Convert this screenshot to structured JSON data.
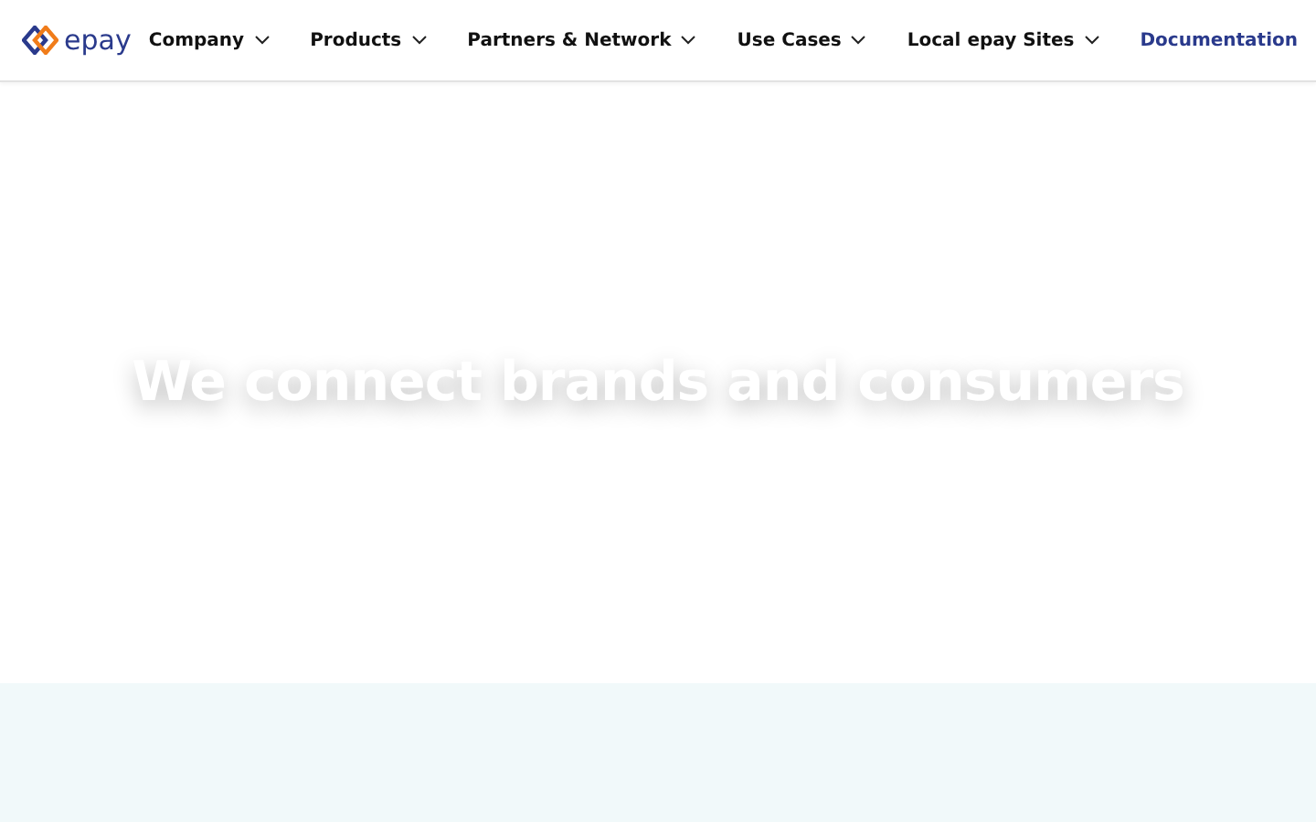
{
  "header": {
    "logo": "epay",
    "nav": [
      {
        "label": "Company",
        "kind": "dropdown"
      },
      {
        "label": "Products",
        "kind": "dropdown"
      },
      {
        "label": "Partners & Network",
        "kind": "dropdown"
      },
      {
        "label": "Use Cases",
        "kind": "dropdown"
      },
      {
        "label": "Local epay Sites",
        "kind": "dropdown"
      },
      {
        "label": "Documentation",
        "kind": "link"
      }
    ]
  },
  "hero": {
    "title": "We connect brands and consumers"
  }
}
